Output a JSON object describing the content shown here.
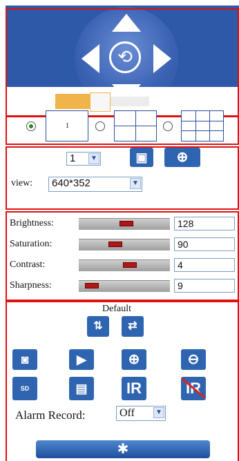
{
  "ptz": {
    "up_arrow": "▲",
    "down_arrow": "▼",
    "left_arrow": "◀",
    "right_arrow": "▶",
    "center_glyph": "⟲",
    "speed_level": 0.5
  },
  "layout": {
    "options": [
      {
        "label": "1",
        "selected": true
      },
      {
        "label": "",
        "selected": false
      },
      {
        "label": "",
        "selected": false
      }
    ]
  },
  "preset": {
    "number": "1",
    "save_icon": "save-icon",
    "goto_icon": "crosshair-icon"
  },
  "view": {
    "label": "view:",
    "value": "640*352"
  },
  "image_settings": [
    {
      "label": "Brightness:",
      "value": "128",
      "position": 0.53
    },
    {
      "label": "Saturation:",
      "value": "90",
      "position": 0.38
    },
    {
      "label": "Contrast:",
      "value": "4",
      "position": 0.57
    },
    {
      "label": "Sharpness:",
      "value": "9",
      "position": 0.08
    }
  ],
  "default": {
    "label": "Default",
    "flip_icon": "flip-icon",
    "mirror_icon": "mirror-icon"
  },
  "tools": {
    "snapshot_icon": "camera-icon",
    "record_icon": "video-camera-icon",
    "zoom_in_icon": "zoom-in-icon",
    "zoom_out_icon": "zoom-out-icon",
    "sd_label": "SD",
    "clapper_icon": "clapperboard-icon",
    "ir_label": "IR",
    "ir_off_label": "IR"
  },
  "alarm": {
    "label": "Alarm Record:",
    "value": "Off"
  },
  "settings": {
    "glyph": "✱"
  }
}
